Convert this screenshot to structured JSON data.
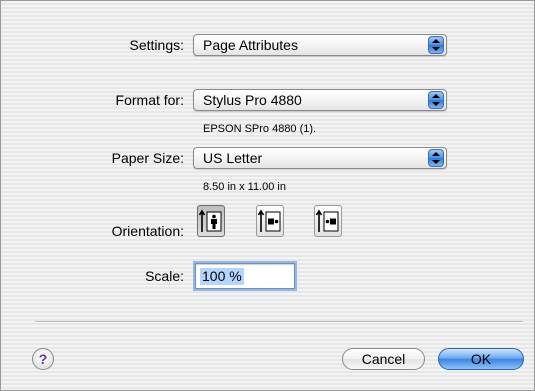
{
  "settings": {
    "label": "Settings:",
    "value": "Page Attributes"
  },
  "format_for": {
    "label": "Format for:",
    "value": "Stylus Pro 4880",
    "detail": "EPSON SPro 4880 (1)."
  },
  "paper_size": {
    "label": "Paper Size:",
    "value": "US Letter",
    "detail": "8.50 in x 11.00 in"
  },
  "orientation": {
    "label": "Orientation:",
    "selected": "portrait",
    "options": [
      "portrait",
      "landscape-left",
      "landscape-right"
    ]
  },
  "scale": {
    "label": "Scale:",
    "value": "100 %"
  },
  "footer": {
    "help_glyph": "?",
    "cancel_label": "Cancel",
    "ok_label": "OK"
  },
  "colors": {
    "accent_blue": "#3f85e3",
    "selection": "#b5d5ff",
    "help_glyph": "#6b2fa0"
  }
}
